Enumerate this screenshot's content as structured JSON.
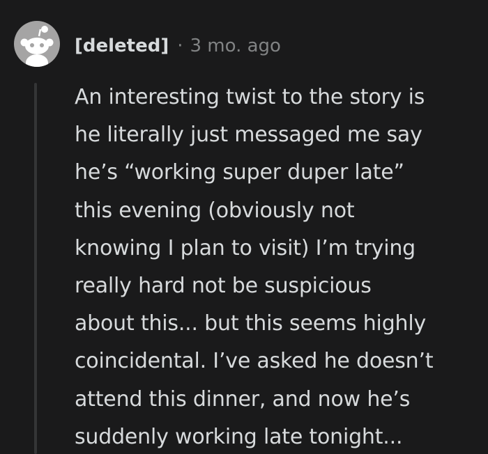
{
  "comment": {
    "author": "[deleted]",
    "separator": "·",
    "age": "3 mo. ago",
    "avatar_icon": "snoo-icon",
    "body_lines": [
      "An interesting twist to the story is",
      "he literally just messaged me say",
      "he’s “working super duper late”",
      "this evening (obviously not",
      "knowing I plan to visit) I’m trying",
      "really hard not be suspicious",
      "about this... but this seems highly",
      "coincidental. I’ve asked he doesn’t",
      "attend this dinner, and now he’s",
      "suddenly working late tonight..."
    ]
  },
  "colors": {
    "background": "#1a1a1b",
    "text": "#d7dadc",
    "muted": "#818384",
    "thread_line": "#343536",
    "avatar_bg": "#a5a4a4"
  }
}
